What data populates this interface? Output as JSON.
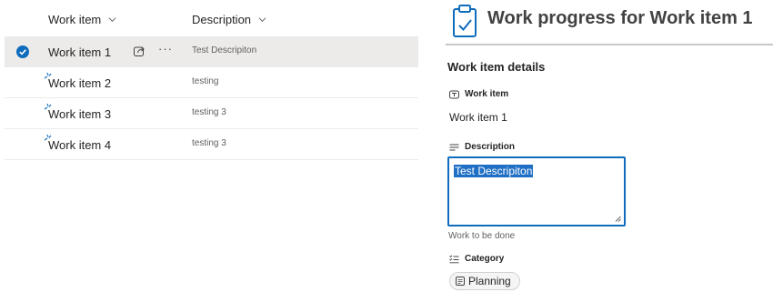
{
  "list": {
    "columns": {
      "name": "Work item",
      "description": "Description"
    },
    "rows": [
      {
        "name": "Work item 1",
        "description": "Test Descripiton",
        "selected": true
      },
      {
        "name": "Work item 2",
        "description": "testing",
        "selected": false
      },
      {
        "name": "Work item 3",
        "description": "testing 3",
        "selected": false
      },
      {
        "name": "Work item 4",
        "description": "testing 3",
        "selected": false
      }
    ],
    "more_label": "···"
  },
  "form": {
    "title": "Work progress for Work item 1",
    "section_title": "Work item details",
    "work_item": {
      "label": "Work item",
      "value": "Work item 1"
    },
    "description": {
      "label": "Description",
      "value": "Test Descripiton",
      "hint": "Work to be done"
    },
    "category": {
      "label": "Category",
      "value": "Planning"
    }
  },
  "colors": {
    "accent": "#0f6cbd",
    "selected_row": "#edebe9",
    "text_selection": "#1f6fc5"
  }
}
